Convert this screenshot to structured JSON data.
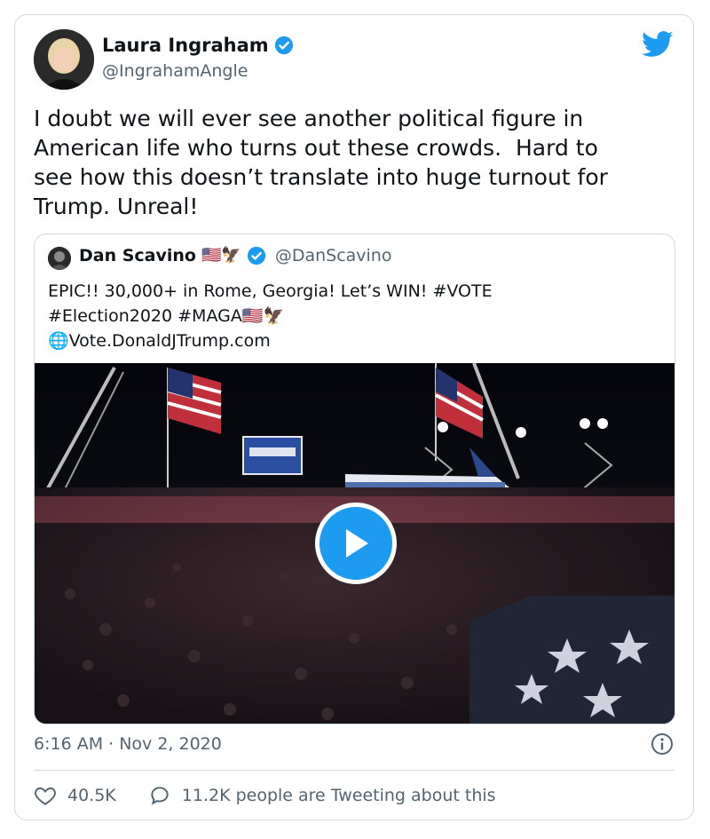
{
  "author": {
    "name": "Laura Ingraham",
    "handle": "@IngrahamAngle"
  },
  "tweet": {
    "text": "I doubt we will ever see another political figure in\nAmerican life who turns out these crowds.  Hard to\nsee how this doesn’t translate into huge turnout for\nTrump. Unreal!"
  },
  "quoted": {
    "name": "Dan Scavino",
    "name_emoji": "🇺🇸🦅",
    "handle": "@DanScavino",
    "text": "EPIC!! 30,000+ in Rome, Georgia! Let’s WIN! #VOTE\n#Election2020 #MAGA🇺🇸🦅\n🌐Vote.DonaldJTrump.com"
  },
  "timestamp": "6:16 AM · Nov 2, 2020",
  "likes": "40.5K",
  "retweet_text": "11.2K people are Tweeting about this",
  "icons": {
    "brand": "twitter-bird-icon",
    "verified": "verified-badge-icon",
    "play": "play-icon",
    "info": "info-icon",
    "like": "heart-icon",
    "reply": "speech-bubble-icon"
  },
  "colors": {
    "accent": "#1d9bf0",
    "text": "#0f1419",
    "secondary": "#536471",
    "border": "#cfd9de"
  }
}
